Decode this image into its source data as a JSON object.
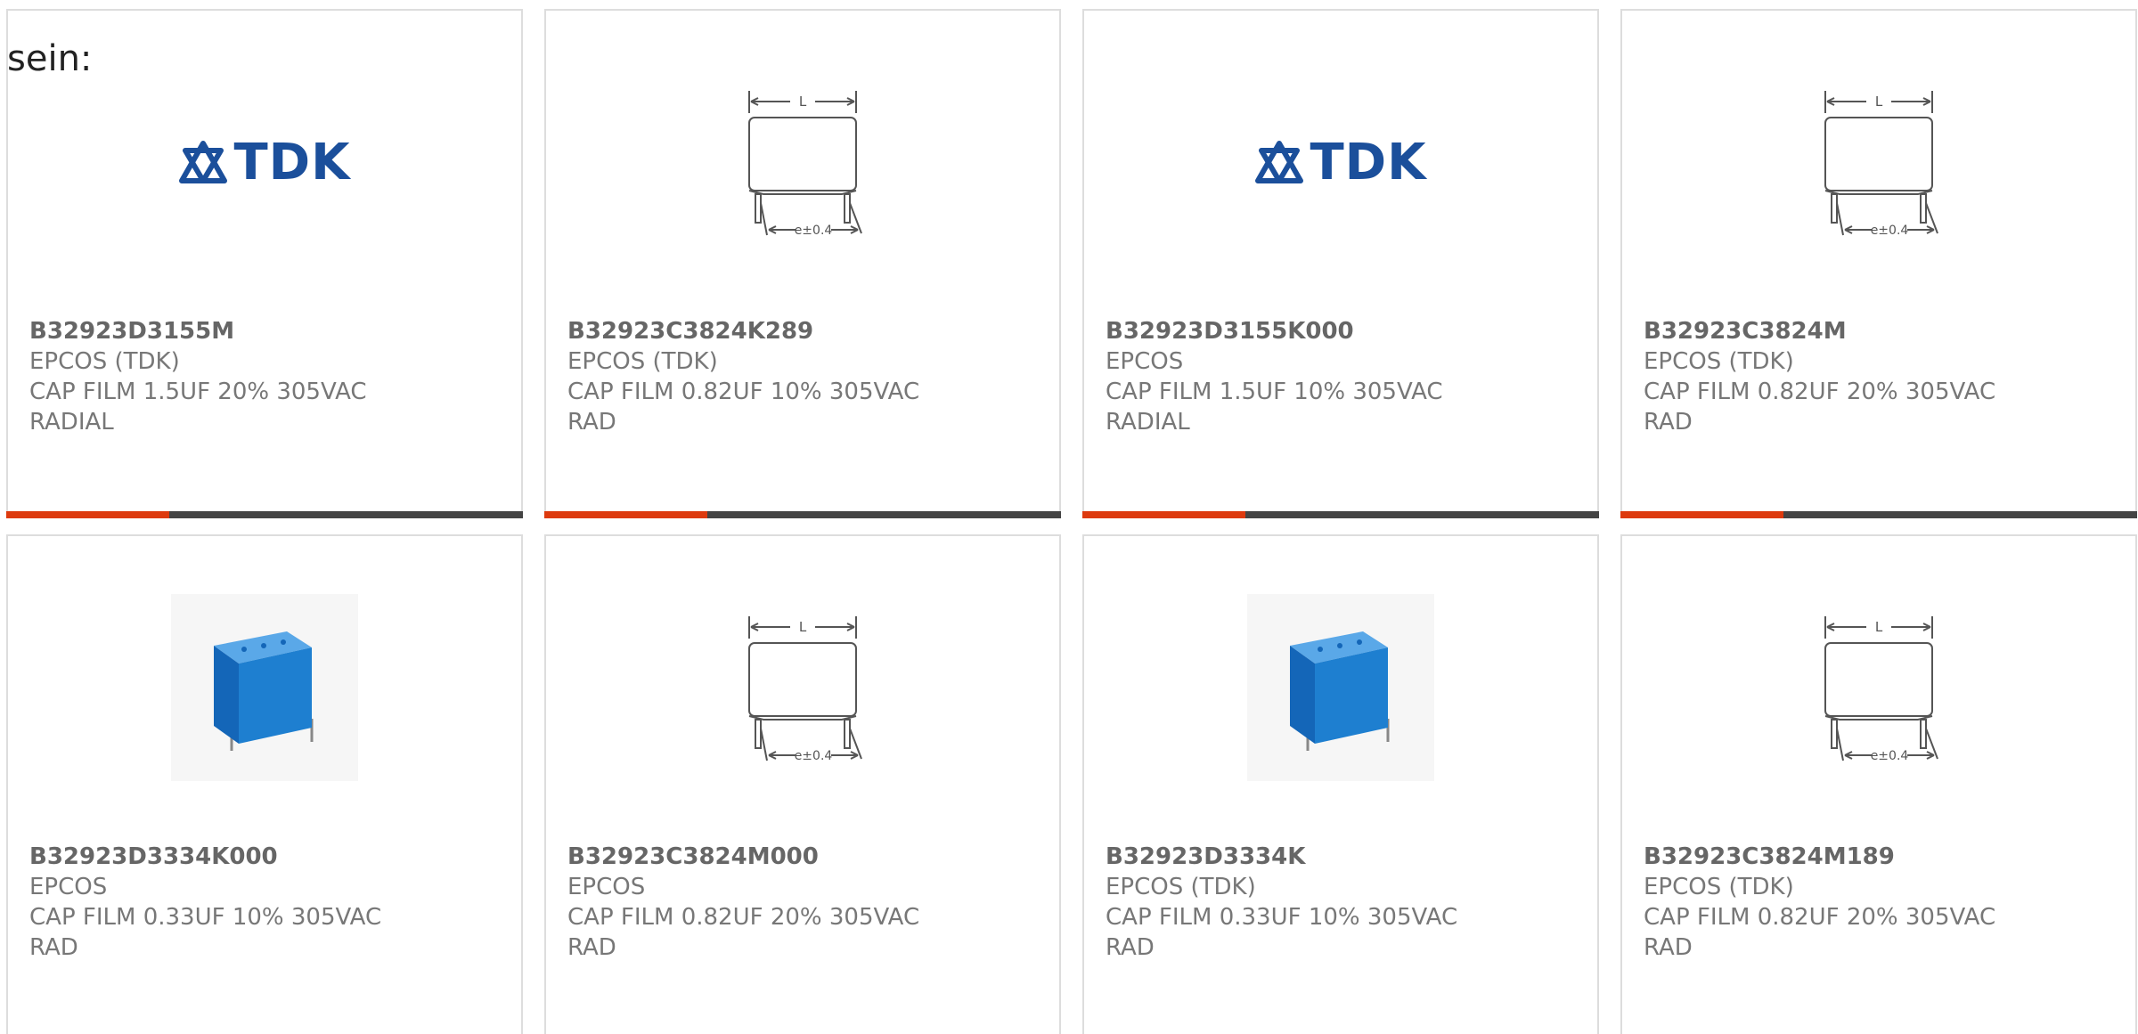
{
  "intro_text": "sein:",
  "colors": {
    "accent": "#dd3a0e",
    "bar_dark": "#444444",
    "tdk_blue": "#1b4f9b",
    "capacitor_blue": "#1e7fd0"
  },
  "drawing_labels": {
    "length": "L",
    "spacing": "e±0.4"
  },
  "products": [
    {
      "part": "B32923D3155M",
      "manufacturer": "EPCOS (TDK)",
      "desc1": "CAP FILM 1.5UF 20% 305VAC",
      "desc2": "RADIAL",
      "image": "tdk-logo",
      "logo_text": "TDK"
    },
    {
      "part": "B32923C3824K289",
      "manufacturer": "EPCOS (TDK)",
      "desc1": "CAP FILM 0.82UF 10% 305VAC",
      "desc2": "RAD",
      "image": "dimension-drawing"
    },
    {
      "part": "B32923D3155K000",
      "manufacturer": "EPCOS",
      "desc1": "CAP FILM 1.5UF 10% 305VAC",
      "desc2": "RADIAL",
      "image": "tdk-logo",
      "logo_text": "TDK"
    },
    {
      "part": "B32923C3824M",
      "manufacturer": "EPCOS (TDK)",
      "desc1": "CAP FILM 0.82UF 20% 305VAC",
      "desc2": "RAD",
      "image": "dimension-drawing"
    },
    {
      "part": "B32923D3334K000",
      "manufacturer": "EPCOS",
      "desc1": "CAP FILM 0.33UF 10% 305VAC",
      "desc2": "RAD",
      "image": "capacitor-photo"
    },
    {
      "part": "B32923C3824M000",
      "manufacturer": "EPCOS",
      "desc1": "CAP FILM 0.82UF 20% 305VAC",
      "desc2": "RAD",
      "image": "dimension-drawing"
    },
    {
      "part": "B32923D3334K",
      "manufacturer": "EPCOS (TDK)",
      "desc1": "CAP FILM 0.33UF 10% 305VAC",
      "desc2": "RAD",
      "image": "capacitor-photo"
    },
    {
      "part": "B32923C3824M189",
      "manufacturer": "EPCOS (TDK)",
      "desc1": "CAP FILM 0.82UF 20% 305VAC",
      "desc2": "RAD",
      "image": "dimension-drawing"
    }
  ]
}
